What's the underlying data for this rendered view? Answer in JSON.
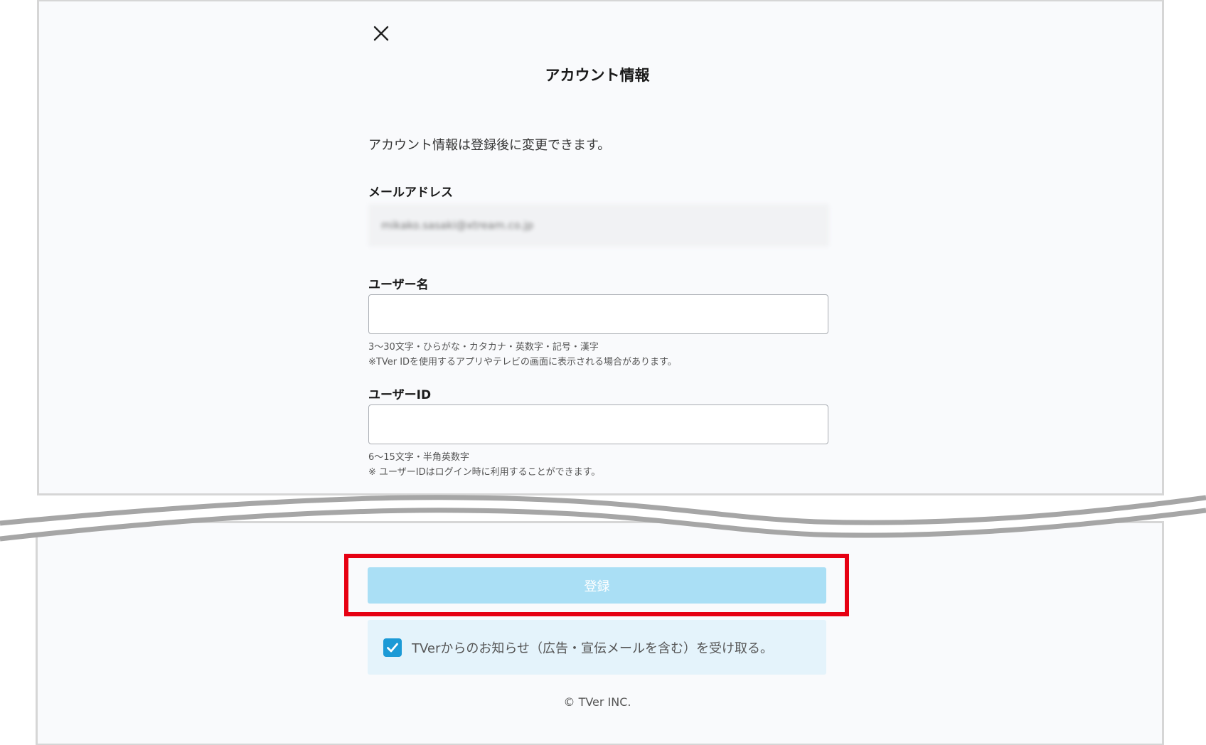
{
  "header": {
    "title": "アカウント情報"
  },
  "intro_text": "アカウント情報は登録後に変更できます。",
  "email": {
    "label": "メールアドレス",
    "value": "mikako.sasaki@xtream.co.jp"
  },
  "username": {
    "label": "ユーザー名",
    "value": "",
    "hint_line1": "3〜30文字・ひらがな・カタカナ・英数字・記号・漢字",
    "hint_line2": "※TVer IDを使用するアプリやテレビの画面に表示される場合があります。"
  },
  "user_id": {
    "label": "ユーザーID",
    "value": "",
    "hint_line1": "6〜15文字・半角英数字",
    "hint_line2": "※ ユーザーIDはログイン時に利用することができます。"
  },
  "register_button": {
    "label": "登録"
  },
  "newsletter": {
    "checked": true,
    "label": "TVerからのお知らせ（広告・宣伝メールを含む）を受け取る。"
  },
  "footer": {
    "copyright": "© TVer INC."
  },
  "colors": {
    "highlight": "#e60012",
    "button_disabled": "#aadff5",
    "checkbox": "#1c9ad6",
    "notice_bg": "#e4f3fb"
  }
}
